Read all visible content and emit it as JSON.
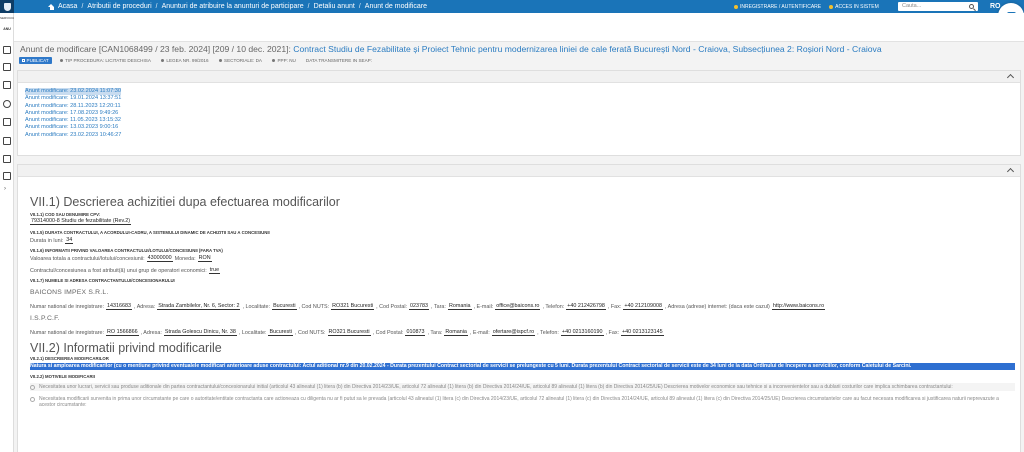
{
  "topbar": {
    "breadcrumbs": [
      "Acasa",
      "Atributii de proceduri",
      "Anunturi de atribuire la anunturi de participare",
      "Detaliu anunt",
      "Anunt de modificare"
    ],
    "links": [
      "INREGISTRARE / AUTENTIFICARE",
      "ACCES IN SISTEM"
    ],
    "search_placeholder": "Cauta...",
    "language": "RO"
  },
  "sidebar": {
    "user": "SERVICIUL",
    "section": "ANU",
    "icons": [
      "list-icon",
      "edit-icon",
      "building-icon",
      "help-icon",
      "gavel-icon",
      "inbox-icon",
      "monitor-icon",
      "chat-icon"
    ]
  },
  "notice": {
    "title_prefix": "Anunt de modificare [CAN1068499 / 23 feb. 2024] [209 / 10 dec. 2021]:",
    "title_main": "Contract Studiu de Fezabilitate și Proiect Tehnic pentru modernizarea liniei de cale ferată București Nord - Craiova, Subsecțiunea 2: Roșiori Nord - Craiova",
    "status_badge": "PUBLICAT",
    "meta": [
      "TIP PROCEDURA: LICITATIE DESCHISA",
      "LEGEA NR. 99/2016",
      "SECTORIALE: DA",
      "PPP: NU",
      "DATA TRANSMITERE IN SEAP:"
    ]
  },
  "history": [
    "Anunt modificare: 23.02.2024 11:07:30",
    "Anunt modificare: 19.01.2024 13:37:51",
    "Anunt modificare: 28.11.2023 12:20:11",
    "Anunt modificare: 17.08.2023 9:49:26",
    "Anunt modificare: 11.05.2023 13:15:32",
    "Anunt modificare: 13.03.2023 9:00:16",
    "Anunt modificare: 23.02.2023 10:46:27"
  ],
  "section7_1": {
    "title": "VII.1) Descrierea achizitiei dupa efectuarea modificarilor",
    "cpv_label": "VII.1.1) COD SAU DENUMIRE CPV:",
    "cpv_value": "79314000-8 Studiu de fezabilitate (Rev.2)",
    "duration_label": "VII.1.5) DURATA CONTRACTULUI, A ACORDULUI-CADRU, A SISTEMULUI DINAMIC DE ACHIZITII SAU A CONCESIUNII",
    "duration_text": "Durata in luni:",
    "duration_value": "34",
    "value_label": "VII.1.6) INFORMATII PRIVIND VALOAREA CONTRACTULUI/LOTULUI/CONCESIUNII (FARA TVA)",
    "value_text": "Valoarea totala a contractului/lotului/concesiunii:",
    "value_amount": "43000000",
    "currency_text": "Moneda:",
    "currency_value": "RON",
    "group_text": "Contractul/concesiunea a fost atribuit(ă) unui grup de operatori economici:",
    "group_value": "true",
    "contractor_label": "VII.1.7) NUMELE SI ADRESA CONTRACTANTULUI/CONCESIONARULUI",
    "company1": {
      "name": "BAICONS IMPEX S.R.L.",
      "reg_label": "Numar national de inregistrare:",
      "reg": "14316683",
      "addr_label": ", Adresa:",
      "addr": "Strada Zambilelor, Nr. 6, Sector: 2",
      "loc_label": ", Localitate:",
      "loc": "Bucuresti",
      "nuts_label": ", Cod NUTS:",
      "nuts": "RO321 Bucuresti",
      "zip_label": ", Cod Postal:",
      "zip": "023783",
      "country_label": ", Tara:",
      "country": "Romania",
      "email_label": ", E-mail:",
      "email": "office@baicons.ro",
      "tel_label": ", Telefon:",
      "tel": "+40 212426798",
      "fax_label": ", Fax:",
      "fax": "+40 212109008",
      "web_label": ", Adresa (adrese) internet: (daca este cazul)",
      "web": "http://www.baicons.ro"
    },
    "company2": {
      "name": "I.S.P.C.F.",
      "reg_label": "Numar national de inregistrare:",
      "reg": "RO 1566866",
      "addr_label": ", Adresa:",
      "addr": "Strada Golescu Dinicu, Nr. 38",
      "loc_label": ", Localitate:",
      "loc": "Bucuresti",
      "nuts_label": ", Cod NUTS:",
      "nuts": "RO321 Bucuresti",
      "zip_label": ", Cod Postal:",
      "zip": "010873",
      "country_label": ", Tara:",
      "country": "Romania",
      "email_label": ", E-mail:",
      "email": "ofertare@ispcf.ro",
      "tel_label": ", Telefon:",
      "tel": "+40 0213160190",
      "fax_label": ", Fax:",
      "fax": "+40 0213123145"
    }
  },
  "section7_2": {
    "title": "VII.2) Informatii privind modificarile",
    "desc_label": "VII.2.1) DESCRIEREA MODIFICARILOR",
    "desc_text": "Natura si amploarea modificarilor (cu o mentiune privind eventualele modificari anterioare aduse contractului:",
    "desc_value": "Actul aditional nr.9 din 20.02.2024 - Durata prezentului Contract sectorial de servicii se prelungeste cu 5 luni. Durata prezentului Contract sectorial de servicii este de 34 luni de la data Ordinului de Incepere a serviciilor, conform Caietului de Sarcini.",
    "reasons_label": "VII.2.2) MOTIVELE MODIFICARII",
    "reason1": "Necesitatea unor lucrari, servicii sau produse aditionale din partea contractantului/concesionarului initial (articolul 43 alineatul (1) litera (b) din Directiva 2014/23/UE, articolul 72 alineatul (1) litera (b) din Directiva 2014/24/UE, articolul 89 alineatul (1) litera (b) din Directiva 2014/25/UE) Descrierea motivelor economice sau tehnice si a inconvenientelor sau a dublarii costurilor care implica schimbarea contractantului:",
    "reason2": "Necesitatea modificarii survenita in prima unor circumstante pe care o autoritate/entitate contractanta care actioneaza cu diligenta nu ar fi putut sa le prevada (articolul 43 alineatul (1) litera (c) din Directiva 2014/23/UE, articolul 72 alineatul (1) litera (c) din Directiva 2014/24/UE, articolul 89 alineatul (1) litera (c) din Directiva 2014/25/UE) Descrierea circumstantelor care au facut necesara modificarea si justificarea naturii neprevazute a acestor circumstante:"
  },
  "colors": {
    "topbar": "#1a74b8",
    "link": "#2b7cc1",
    "highlight": "#2e6fd1"
  }
}
